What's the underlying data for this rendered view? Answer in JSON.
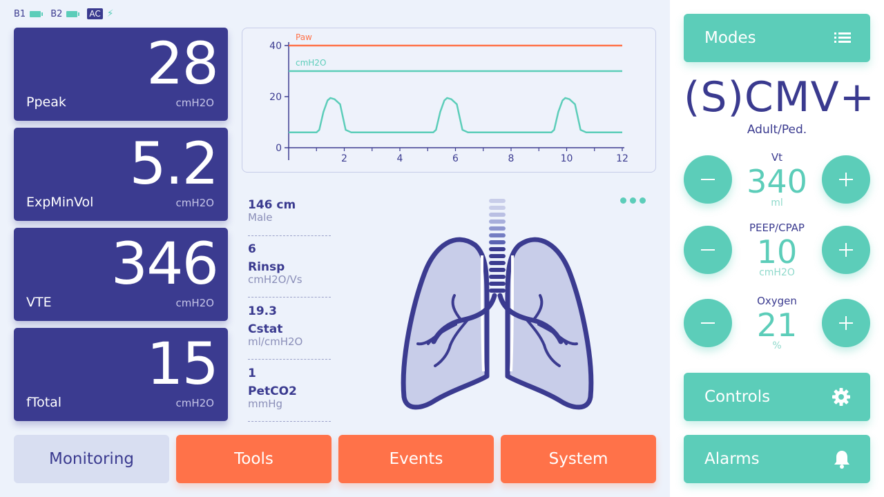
{
  "status": {
    "b1": "B1",
    "b2": "B2",
    "ac": "AC"
  },
  "metrics": [
    {
      "value": "28",
      "name": "Ppeak",
      "unit": "cmH2O"
    },
    {
      "value": "5.2",
      "name": "ExpMinVol",
      "unit": "cmH2O"
    },
    {
      "value": "346",
      "name": "VTE",
      "unit": "cmH2O"
    },
    {
      "value": "15",
      "name": "fTotal",
      "unit": "cmH2O"
    }
  ],
  "chart_data": {
    "type": "line",
    "series": [
      {
        "name": "Paw",
        "color": "#ff7249",
        "x": [
          0,
          12
        ],
        "y": [
          40,
          40
        ]
      },
      {
        "name": "cmH2O",
        "color": "#5ccdb9",
        "x": [
          0,
          12
        ],
        "y": [
          30,
          30
        ]
      },
      {
        "name": "",
        "color": "#5ccdb9",
        "x": [
          0,
          1.0,
          1.1,
          1.25,
          1.4,
          1.5,
          1.65,
          1.85,
          1.95,
          2.05,
          2.25,
          5.2,
          5.3,
          5.45,
          5.6,
          5.7,
          5.85,
          6.05,
          6.15,
          6.25,
          6.45,
          9.45,
          9.55,
          9.7,
          9.85,
          9.95,
          10.1,
          10.3,
          10.4,
          10.5,
          10.7,
          12
        ],
        "y": [
          6,
          6,
          7,
          14,
          18.5,
          19.5,
          19,
          17,
          12,
          7,
          6,
          6,
          7,
          14,
          18.5,
          19.5,
          19,
          17,
          12,
          7,
          6,
          6,
          7,
          14,
          18.5,
          19.5,
          19,
          17,
          12,
          7,
          6,
          6
        ]
      }
    ],
    "xlim": [
      0,
      12
    ],
    "ylim": [
      0,
      40
    ],
    "xticks": [
      2,
      4,
      6,
      8,
      10,
      12
    ],
    "yticks": [
      0,
      20,
      40
    ]
  },
  "patient": [
    {
      "value": "146 cm",
      "label": "Male",
      "unit": ""
    },
    {
      "value": "6",
      "label": "Rinsp",
      "unit": "cmH2O/Vs"
    },
    {
      "value": "19.3",
      "label": "Cstat",
      "unit": "ml/cmH2O"
    },
    {
      "value": "1",
      "label": "PetCO2",
      "unit": "mmHg"
    }
  ],
  "nav": {
    "monitoring": "Monitoring",
    "tools": "Tools",
    "events": "Events",
    "system": "System"
  },
  "modes_label": "Modes",
  "mode": {
    "name": "(S)CMV+",
    "sub": "Adult/Ped."
  },
  "controls": [
    {
      "label": "Vt",
      "value": "340",
      "unit": "ml"
    },
    {
      "label": "PEEP/CPAP",
      "value": "10",
      "unit": "cmH2O"
    },
    {
      "label": "Oxygen",
      "value": "21",
      "unit": "%"
    }
  ],
  "controls_label": "Controls",
  "alarms_label": "Alarms",
  "colors": {
    "indigo": "#3b3b90",
    "teal": "#5ccdb9",
    "orange": "#ff7249",
    "background": "#edf2fb"
  }
}
